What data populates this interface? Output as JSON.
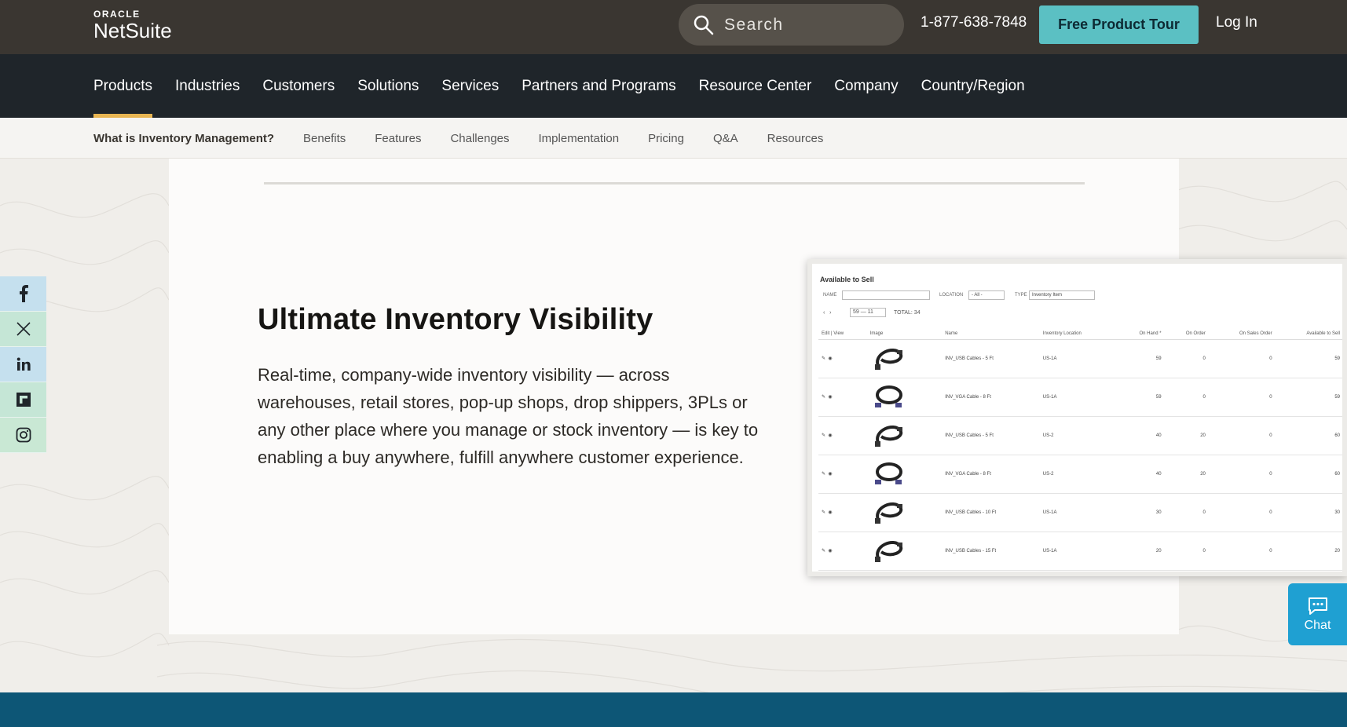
{
  "header": {
    "logo_top": "ORACLE",
    "logo_main": "NetSuite",
    "search_placeholder": "Search",
    "phone": "1-877-638-7848",
    "tour_button": "Free Product Tour",
    "login": "Log In"
  },
  "main_nav": [
    {
      "label": "Products",
      "active": true
    },
    {
      "label": "Industries"
    },
    {
      "label": "Customers"
    },
    {
      "label": "Solutions"
    },
    {
      "label": "Services"
    },
    {
      "label": "Partners and Programs"
    },
    {
      "label": "Resource Center"
    },
    {
      "label": "Company"
    },
    {
      "label": "Country/Region"
    }
  ],
  "sub_nav": [
    {
      "label": "What is Inventory Management?",
      "current": true
    },
    {
      "label": "Benefits"
    },
    {
      "label": "Features"
    },
    {
      "label": "Challenges"
    },
    {
      "label": "Implementation"
    },
    {
      "label": "Pricing"
    },
    {
      "label": "Q&A"
    },
    {
      "label": "Resources"
    }
  ],
  "content": {
    "headline": "Ultimate Inventory Visibility",
    "body": "Real-time, company-wide inventory visibility — across warehouses, retail stores, pop-up shops, drop shippers, 3PLs or any other place where you manage or stock inventory — is key to enabling a buy anywhere, fulfill anywhere customer experience."
  },
  "screenshot": {
    "title": "Available to Sell",
    "filters": {
      "name_label": "NAME",
      "location_label": "LOCATION",
      "location_value": "- All -",
      "type_label": "TYPE",
      "type_value": "Inventory Item"
    },
    "pager": {
      "range": "59 — 11",
      "total": "TOTAL: 34"
    },
    "columns": [
      "Edit | View",
      "Image",
      "Name",
      "Inventory Location",
      "On Hand *",
      "On Order",
      "On Sales Order",
      "Available to Sell"
    ],
    "rows": [
      {
        "name": "INV_USB Cables - 5 Ft",
        "location": "US-1A",
        "on_hand": "59",
        "on_order": "0",
        "on_sales": "0",
        "available": "59"
      },
      {
        "name": "INV_VGA Cable - 8 Ft",
        "location": "US-1A",
        "on_hand": "59",
        "on_order": "0",
        "on_sales": "0",
        "available": "59"
      },
      {
        "name": "INV_USB Cables - 5 Ft",
        "location": "US-2",
        "on_hand": "40",
        "on_order": "20",
        "on_sales": "0",
        "available": "60"
      },
      {
        "name": "INV_VGA Cable - 8 Ft",
        "location": "US-2",
        "on_hand": "40",
        "on_order": "20",
        "on_sales": "0",
        "available": "60"
      },
      {
        "name": "INV_USB Cables - 10 Ft",
        "location": "US-1A",
        "on_hand": "30",
        "on_order": "0",
        "on_sales": "0",
        "available": "30"
      },
      {
        "name": "INV_USB Cables - 15 Ft",
        "location": "US-1A",
        "on_hand": "20",
        "on_order": "0",
        "on_sales": "0",
        "available": "20"
      }
    ]
  },
  "social": [
    "facebook-icon",
    "x-icon",
    "linkedin-icon",
    "flipboard-icon",
    "instagram-icon"
  ],
  "chat_label": "Chat",
  "colors": {
    "topbar": "#3a3631",
    "mainnav": "#1f252a",
    "accent": "#e8b552",
    "tour": "#5bc0c3",
    "chat": "#1fa0d2",
    "footer_band": "#0d5676"
  }
}
